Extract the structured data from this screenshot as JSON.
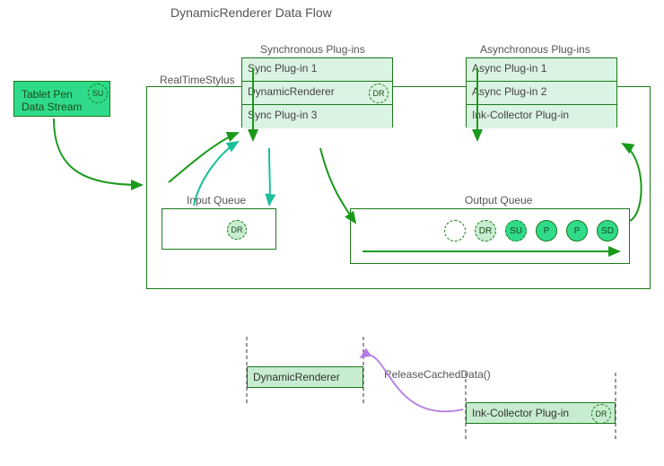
{
  "title": "DynamicRenderer Data Flow",
  "tablet": {
    "line1": "Tablet Pen",
    "line2": "Data Stream",
    "token": "SU"
  },
  "container_label": "RealTimeStylus",
  "sync": {
    "title": "Synchronous Plug-ins",
    "rows": [
      "Sync Plug-in 1",
      "DynamicRenderer",
      "Sync Plug-in 3"
    ],
    "token": "DR"
  },
  "async": {
    "title": "Asynchronous Plug-ins",
    "rows": [
      "Async Plug-in 1",
      "Async Plug-in 2",
      "Ink-Collector Plug-in"
    ]
  },
  "input_queue": {
    "title": "Input Queue",
    "token": "DR"
  },
  "output_queue": {
    "title": "Output Queue",
    "tokens": [
      "",
      "DR",
      "SU",
      "P",
      "P",
      "SD"
    ]
  },
  "bottom": {
    "left_label": "DynamicRenderer",
    "right_label": "Ink-Collector Plug-in",
    "method": "ReleaseCachedData()",
    "token": "DR"
  },
  "colors": {
    "border": "#1a7a1a",
    "fill_mid": "#c7eccf",
    "fill_light": "#dbf3e2",
    "fill_dark": "#2fdb8a",
    "arrow_green": "#1a9a1a",
    "arrow_teal": "#1abf9a",
    "arrow_purple": "#b57be6"
  }
}
